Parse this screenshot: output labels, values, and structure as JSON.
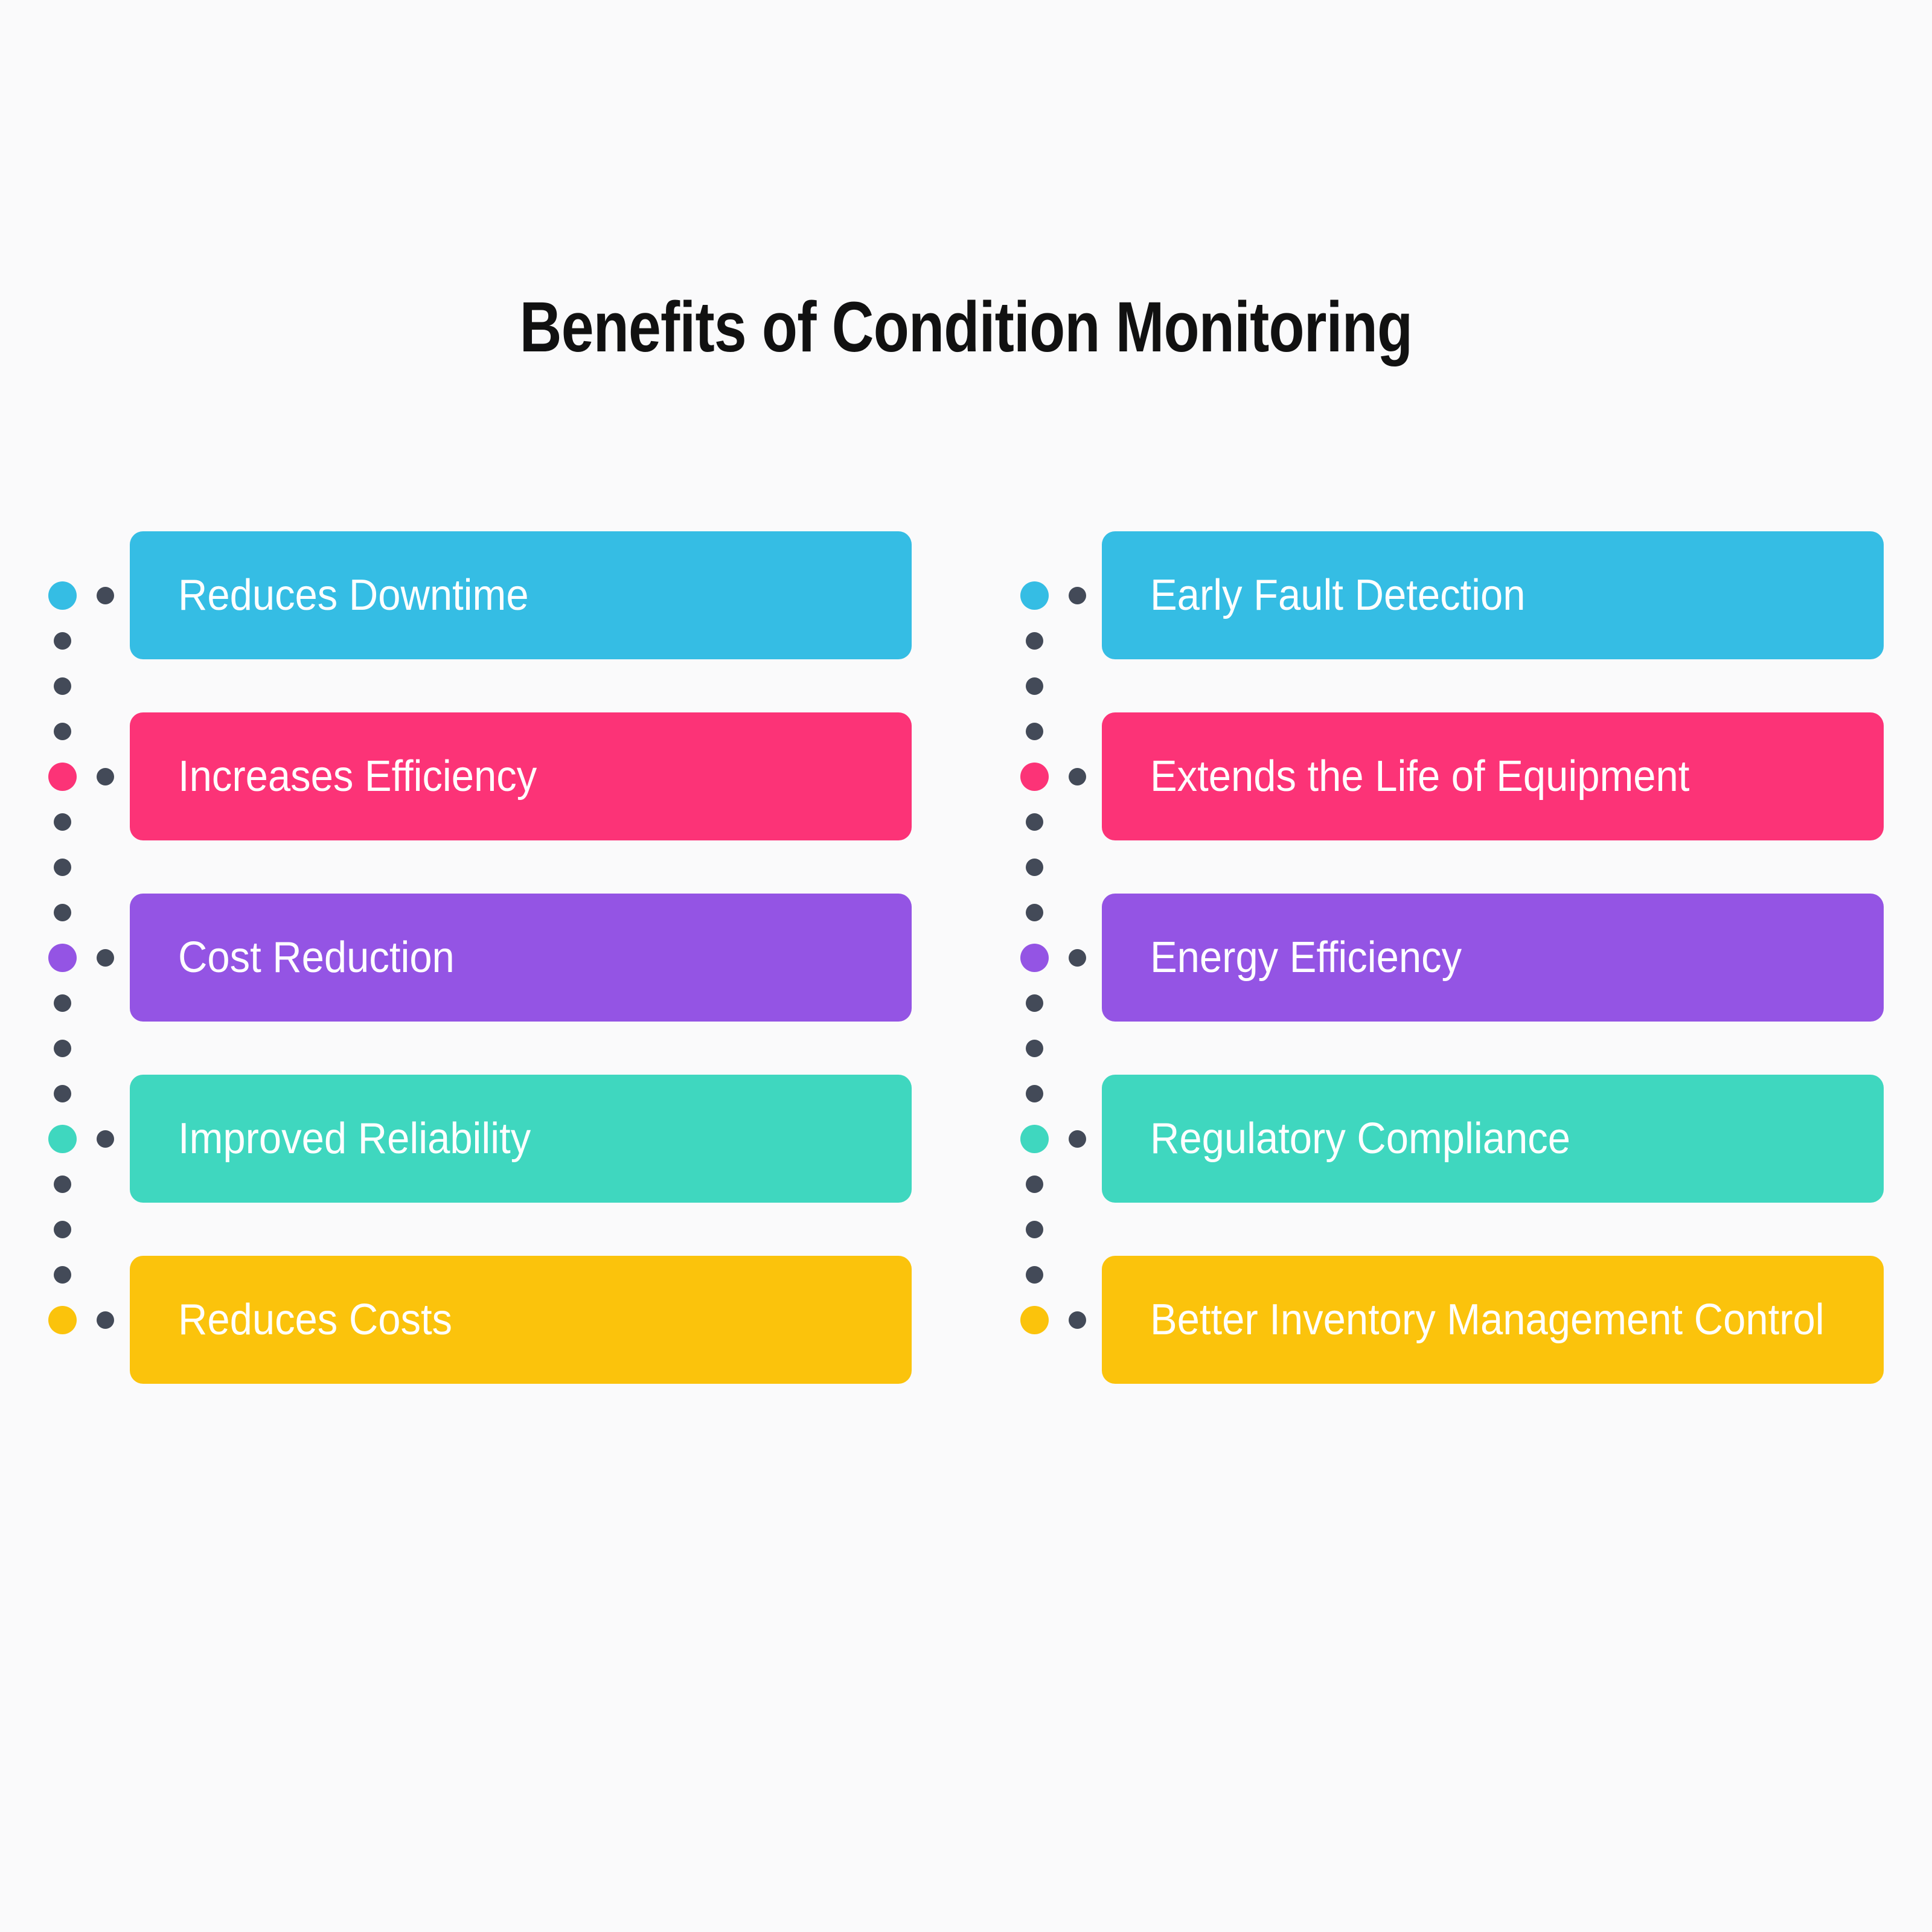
{
  "page": {
    "title": "Benefits of Condition Monitoring",
    "background_color": "#FAFAFB",
    "title_color": "#111111",
    "dot_color": "#434A58",
    "label_color": "#FFFFFF"
  },
  "palette": {
    "cyan": "#35BDE4",
    "pink": "#FC3377",
    "purple": "#9454E4",
    "teal": "#3FD7BF",
    "yellow": "#FBC30C"
  },
  "columns": [
    {
      "name": "left-column",
      "items": [
        {
          "label": "Reduces Downtime",
          "color": "#35BDE4"
        },
        {
          "label": "Increases Efficiency",
          "color": "#FC3377"
        },
        {
          "label": "Cost Reduction",
          "color": "#9454E4"
        },
        {
          "label": "Improved Reliability",
          "color": "#3FD7BF"
        },
        {
          "label": "Reduces Costs",
          "color": "#FBC30C"
        }
      ]
    },
    {
      "name": "right-column",
      "items": [
        {
          "label": "Early Fault Detection",
          "color": "#35BDE4"
        },
        {
          "label": "Extends the Life of Equipment",
          "color": "#FC3377"
        },
        {
          "label": "Energy Efficiency",
          "color": "#9454E4"
        },
        {
          "label": "Regulatory Compliance",
          "color": "#3FD7BF"
        },
        {
          "label": "Better Inventory Management Control",
          "color": "#FBC30C"
        }
      ]
    }
  ]
}
